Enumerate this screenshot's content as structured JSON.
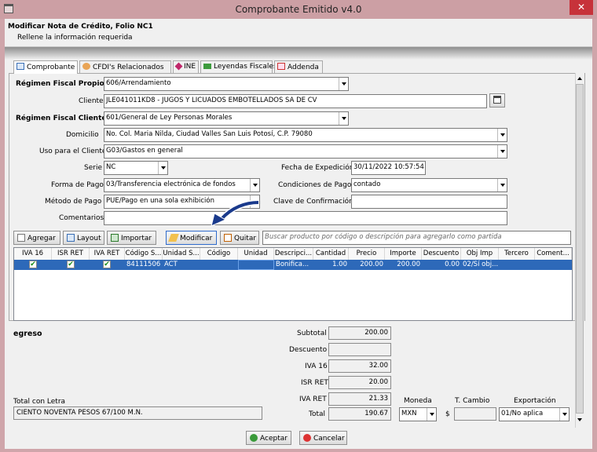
{
  "window": {
    "title": "Comprobante Emitido v4.0",
    "close": "✕"
  },
  "header": {
    "title": "Modificar Nota de Crédito, Folio NC1",
    "subtitle": "Rellene la información requerida"
  },
  "tabs": [
    {
      "label": "Comprobante",
      "icon": "document-icon"
    },
    {
      "label": "CFDI's Relacionados",
      "icon": "users-icon"
    },
    {
      "label": "INE",
      "icon": "diamond-icon"
    },
    {
      "label": "Leyendas Fiscales",
      "icon": "folder-icon"
    },
    {
      "label": "Addenda",
      "icon": "addenda-icon"
    }
  ],
  "form": {
    "regimen_propio_label": "Régimen Fiscal Propio (*)",
    "regimen_propio": "606/Arrendamiento",
    "cliente_label": "Cliente",
    "cliente": "JLE041011KD8 - JUGOS Y LICUADOS EMBOTELLADOS SA DE CV",
    "regimen_cliente_label": "Régimen Fiscal Cliente (*)",
    "regimen_cliente": "601/General de Ley Personas Morales",
    "domicilio_label": "Domicilio",
    "domicilio": "No.  Col. Maria Nilda, Ciudad Valles San Luis Potosí, C.P. 79080",
    "uso_label": "Uso para el Cliente",
    "uso": "G03/Gastos en general",
    "serie_label": "Serie",
    "serie": "NC",
    "fecha_label": "Fecha de Expedición",
    "fecha": "30/11/2022 10:57:54",
    "forma_label": "Forma de Pago",
    "forma": "03/Transferencia electrónica de fondos",
    "condiciones_label": "Condiciones de Pago",
    "condiciones": "contado",
    "metodo_label": "Método de Pago",
    "metodo": "PUE/Pago en una sola exhibición",
    "clave_label": "Clave de Confirmación",
    "clave": "",
    "comentarios_label": "Comentarios",
    "comentarios": ""
  },
  "toolbar": {
    "agregar": "Agregar",
    "layout": "Layout",
    "importar": "Importar",
    "modificar": "Modificar",
    "quitar": "Quitar",
    "search_placeholder": "Buscar producto por código o descripción para agregarlo como partida"
  },
  "grid": {
    "headers": [
      "IVA 16",
      "ISR RET",
      "IVA RET",
      "Código S...",
      "Unidad S...",
      "Código",
      "Unidad",
      "Descripci...",
      "Cantidad",
      "Precio",
      "Importe",
      "Descuento",
      "Obj Imp",
      "Tercero",
      "Coment..."
    ],
    "rows": [
      {
        "iva16": true,
        "isr_ret": true,
        "iva_ret": true,
        "codigo_s": "84111506",
        "unidad_s": "ACT",
        "codigo": "",
        "unidad": "",
        "descripcion": "Bonifica...",
        "cantidad": "1.00",
        "precio": "200.00",
        "importe": "200.00",
        "descuento": "0.00",
        "obj_imp": "02/Sí obj...",
        "tercero": "",
        "comentario": ""
      }
    ]
  },
  "totals": {
    "tipo": "egreso",
    "subtotal_label": "Subtotal",
    "subtotal": "200.00",
    "descuento_label": "Descuento",
    "descuento": "",
    "iva16_label": "IVA 16",
    "iva16": "32.00",
    "isr_ret_label": "ISR RET",
    "isr_ret": "20.00",
    "iva_ret_label": "IVA RET",
    "iva_ret": "21.33",
    "total_label": "Total",
    "total": "190.67",
    "letra_label": "Total con Letra",
    "letra": "CIENTO NOVENTA PESOS 67/100 M.N.",
    "moneda_label": "Moneda",
    "moneda": "MXN",
    "tcambio_label": "T. Cambio",
    "tcambio_symbol": "$",
    "tcambio": "",
    "exportacion_label": "Exportación",
    "exportacion": "01/No aplica"
  },
  "footer": {
    "aceptar": "Aceptar",
    "cancelar": "Cancelar"
  },
  "colors": {
    "selection": "#2d69b9",
    "title_bar": "#cc9fa4",
    "close": "#c7323a"
  }
}
